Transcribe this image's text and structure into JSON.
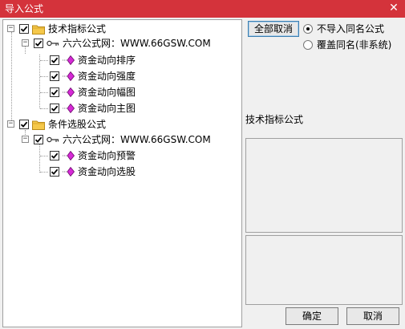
{
  "window": {
    "title": "导入公式",
    "close_glyph": "✕"
  },
  "tree": {
    "groups": [
      {
        "label": "技术指标公式",
        "expander": "−",
        "source": {
          "label": "六六公式网：WWW.66GSW.COM",
          "expander": "−",
          "items": [
            "资金动向排序",
            "资金动向强度",
            "资金动向幅图",
            "资金动向主图"
          ]
        }
      },
      {
        "label": "条件选股公式",
        "expander": "−",
        "source": {
          "label": "六六公式网：WWW.66GSW.COM",
          "expander": "−",
          "items": [
            "资金动向预警",
            "资金动向选股"
          ]
        }
      }
    ]
  },
  "right": {
    "cancel_all": "全部取消",
    "options": [
      {
        "label": "不导入同名公式",
        "selected": true
      },
      {
        "label": "覆盖同名(非系统)",
        "selected": false
      }
    ],
    "detail_label": "技术指标公式"
  },
  "footer": {
    "ok": "确定",
    "cancel": "取消"
  },
  "colors": {
    "titlebar": "#d4333b",
    "folder": "#f5c84a",
    "gem": "#d62ad6",
    "key": "#333333"
  }
}
